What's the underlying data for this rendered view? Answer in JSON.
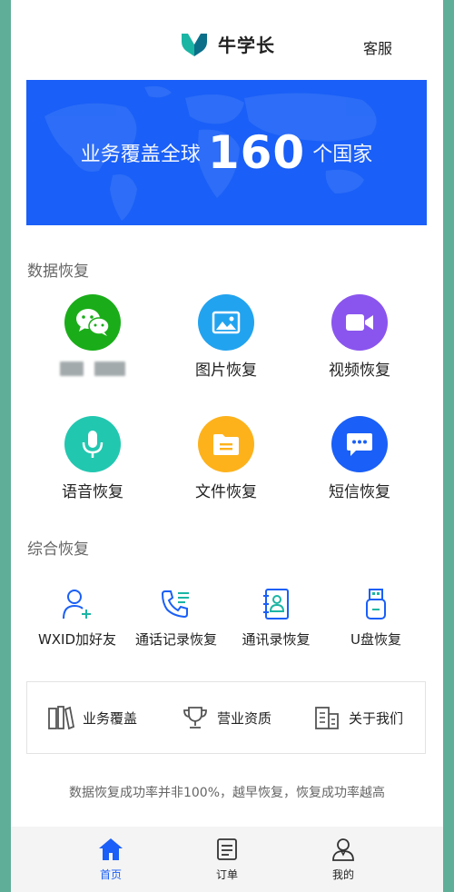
{
  "header": {
    "app_name": "牛学长",
    "service": "客服"
  },
  "banner": {
    "pre": "业务覆盖全球",
    "number": "160",
    "post": "个国家"
  },
  "data_recovery": {
    "title": "数据恢复",
    "items": [
      {
        "label": "",
        "icon": "wechat-icon",
        "color": "#1aad19"
      },
      {
        "label": "图片恢复",
        "icon": "image-icon",
        "color": "#22a3ef"
      },
      {
        "label": "视频恢复",
        "icon": "video-icon",
        "color": "#8a55ee"
      },
      {
        "label": "语音恢复",
        "icon": "microphone-icon",
        "color": "#22c7b0"
      },
      {
        "label": "文件恢复",
        "icon": "folder-icon",
        "color": "#fdb21c"
      },
      {
        "label": "短信恢复",
        "icon": "message-icon",
        "color": "#1a5ff7"
      }
    ]
  },
  "combined_recovery": {
    "title": "综合恢复",
    "items": [
      {
        "label": "WXID加好友",
        "icon": "add-friend-icon"
      },
      {
        "label": "通话记录恢复",
        "icon": "phone-log-icon"
      },
      {
        "label": "通讯录恢复",
        "icon": "contacts-icon"
      },
      {
        "label": "U盘恢复",
        "icon": "usb-drive-icon"
      }
    ]
  },
  "links": [
    {
      "label": "业务覆盖",
      "icon": "books-icon"
    },
    {
      "label": "营业资质",
      "icon": "trophy-icon"
    },
    {
      "label": "关于我们",
      "icon": "building-icon"
    }
  ],
  "disclaimer": "数据恢复成功率并非100%，越早恢复，恢复成功率越高",
  "tabbar": {
    "active_color": "#1a5ff7",
    "tabs": [
      {
        "label": "首页",
        "icon": "home-icon",
        "active": true
      },
      {
        "label": "订单",
        "icon": "orders-icon",
        "active": false
      },
      {
        "label": "我的",
        "icon": "profile-icon",
        "active": false
      }
    ]
  }
}
